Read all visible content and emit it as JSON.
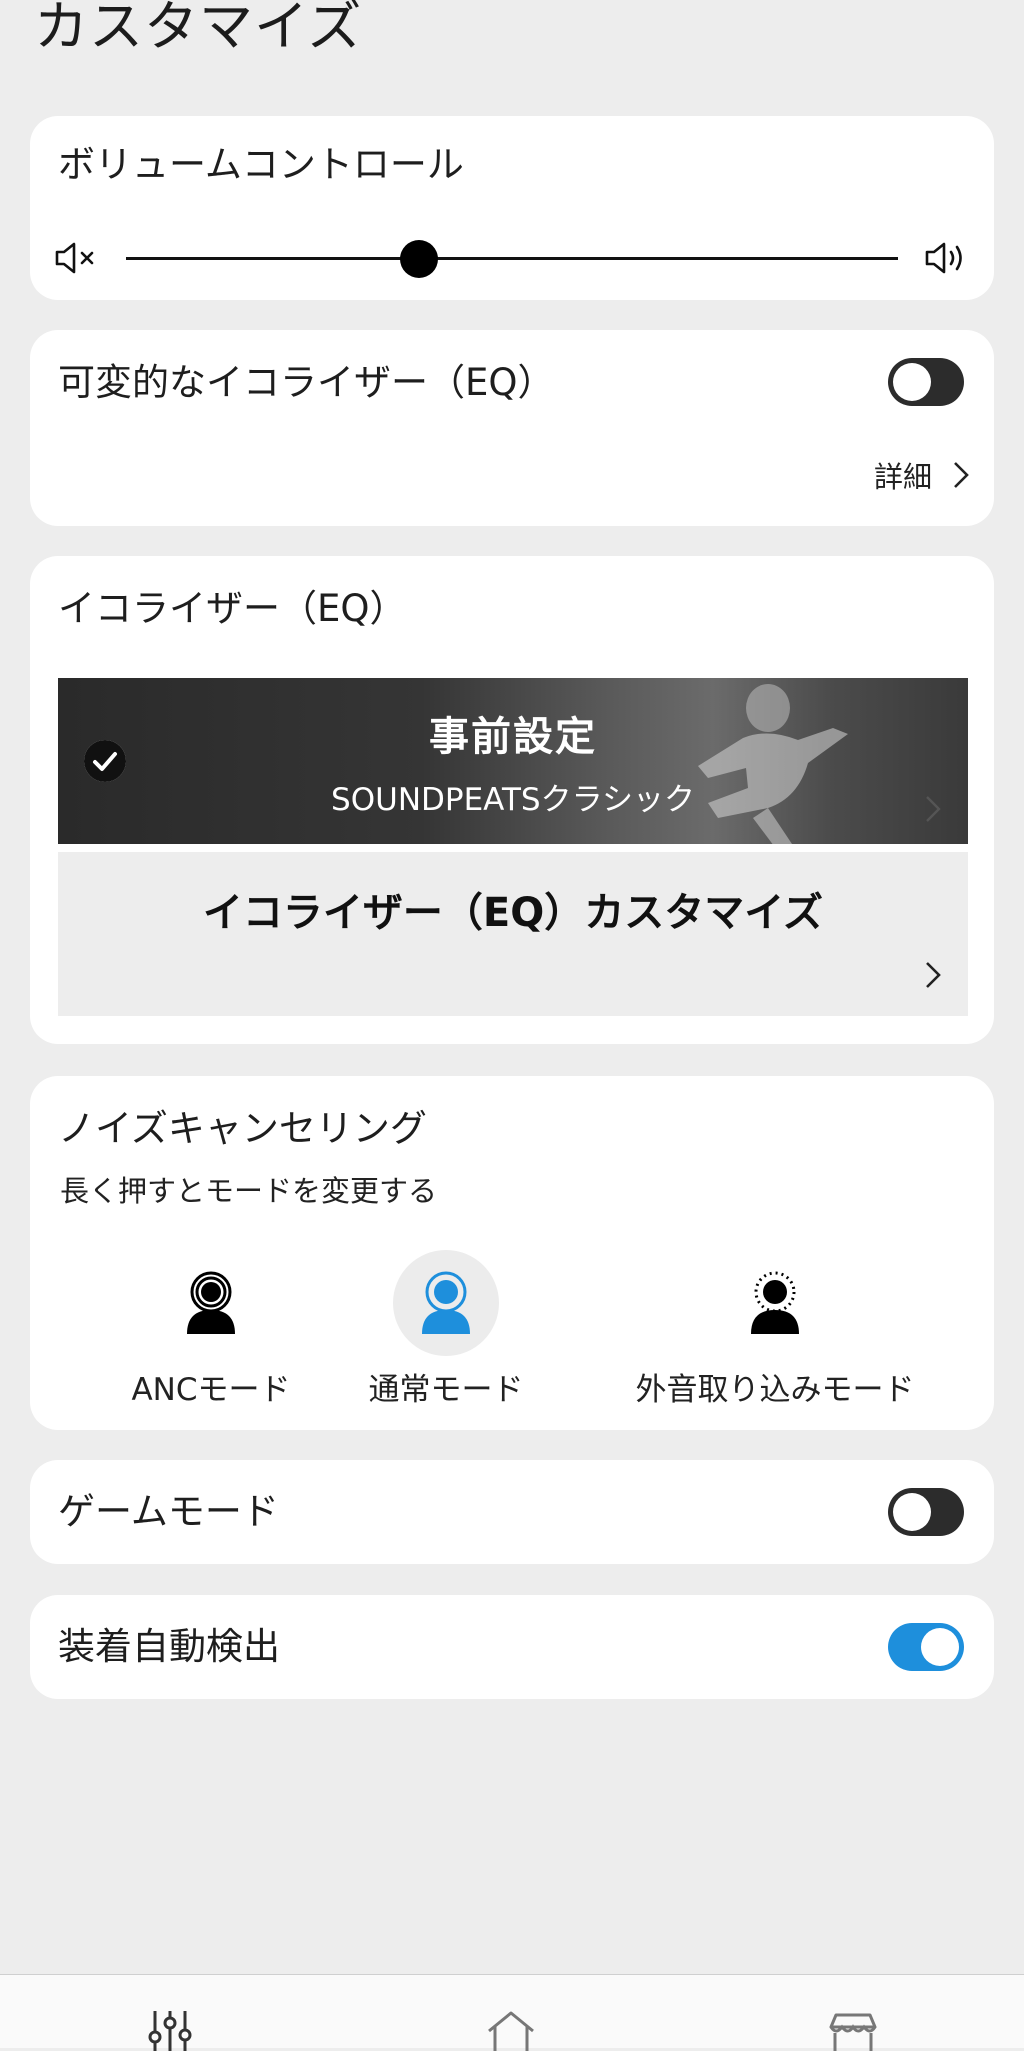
{
  "page": {
    "title": "カスタマイズ"
  },
  "volume": {
    "title": "ボリュームコントロール",
    "level": 0.38,
    "mute_icon": "speaker-mute-icon",
    "loud_icon": "speaker-loud-icon"
  },
  "variable_eq": {
    "title": "可変的なイコライザー（EQ）",
    "enabled": false,
    "details_label": "詳細"
  },
  "equalizer": {
    "title": "イコライザー（EQ）",
    "preset": {
      "title": "事前設定",
      "subtitle": "SOUNDPEATSクラシック",
      "selected": true
    },
    "custom": {
      "title": "イコライザー（EQ）カスタマイズ"
    }
  },
  "noise_cancelling": {
    "title": "ノイズキャンセリング",
    "subtitle": "長く押すとモードを変更する",
    "modes": [
      {
        "label": "ANCモード",
        "icon": "anc-mode-icon",
        "active": false
      },
      {
        "label": "通常モード",
        "icon": "normal-mode-icon",
        "active": true
      },
      {
        "label": "外音取り込みモード",
        "icon": "ambient-mode-icon",
        "active": false
      }
    ],
    "active_color": "#1e8fdc"
  },
  "game_mode": {
    "title": "ゲームモード",
    "enabled": false
  },
  "wear_detection": {
    "title": "装着自動検出",
    "enabled": true
  },
  "bottom_nav": {
    "items": [
      {
        "icon": "equalizer-sliders-icon"
      },
      {
        "icon": "home-icon"
      },
      {
        "icon": "store-icon"
      }
    ]
  }
}
